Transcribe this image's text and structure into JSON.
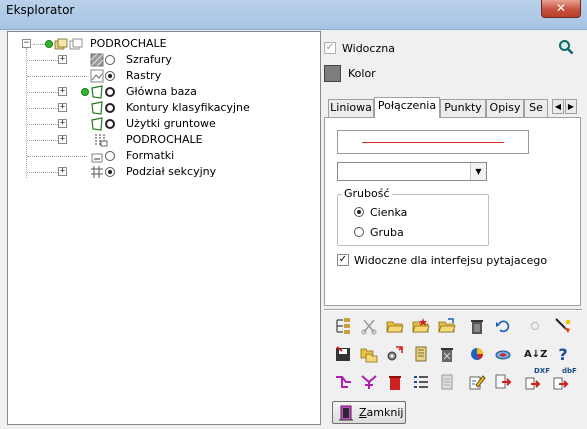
{
  "window": {
    "title": "Eksplorator",
    "close_glyph": "✕"
  },
  "tree": {
    "root": {
      "label": "PODROCHALE",
      "expander": "−"
    },
    "items": [
      {
        "label": "Szrafury",
        "expander": "+",
        "icon": "hatch-layers-icon",
        "radio": "empty"
      },
      {
        "label": "Rastry",
        "expander": "",
        "icon": "raster-image-icon",
        "radio": "filled"
      },
      {
        "label": "Główna baza",
        "expander": "+",
        "icon": "polygon-layer-icon",
        "radio": "bold",
        "dot": true
      },
      {
        "label": "Kontury klasyfikacyjne",
        "expander": "+",
        "icon": "polygon-layer-icon",
        "radio": "bold"
      },
      {
        "label": "Użytki gruntowe",
        "expander": "+",
        "icon": "polygon-layer-icon",
        "radio": "bold"
      },
      {
        "label": "PODROCHALE",
        "expander": "+",
        "icon": "document-grid-icon",
        "radio": "none"
      },
      {
        "label": "Formatki",
        "expander": "",
        "icon": "sheet-frame-icon",
        "radio": "empty"
      },
      {
        "label": "Podział sekcyjny",
        "expander": "+",
        "icon": "grid-icon",
        "radio": "filled"
      }
    ]
  },
  "props": {
    "visible": {
      "label": "Widoczna",
      "checked": true
    },
    "color": {
      "label": "Kolor",
      "value": "#7d7d7d"
    },
    "tabs": [
      "Liniowa",
      "Połączenia",
      "Punkty",
      "Opisy",
      "Se"
    ],
    "active_tab": "Połączenia",
    "line_color": "#d8302a",
    "combo_value": "",
    "thickness": {
      "title": "Grubość",
      "options": [
        {
          "label": "Cienka",
          "selected": true
        },
        {
          "label": "Gruba",
          "selected": false
        }
      ]
    },
    "query_visible": {
      "label": "Widoczne dla interfejsu pytajacego",
      "checked": true
    }
  },
  "toolbar": {
    "rows": [
      [
        "layer-tree-icon",
        "scissors-icon",
        "open-folder-icon",
        "open-folder-star-icon",
        "open-folder-arrow-icon",
        "trash-icon",
        "undo-icon",
        "circle-icon",
        "paint-icon"
      ],
      [
        "save-icon",
        "copy-folder-icon",
        "settings-icon",
        "stack-icon",
        "clear-icon",
        "pie-icon",
        "ellipse-icon",
        "sort-az-icon",
        "help-icon"
      ],
      [
        "branch-icon",
        "branch-alt-icon",
        "delete-red-icon",
        "list-icon",
        "calculator-icon",
        "edit-icon",
        "export-icon",
        "export-dxf-icon",
        "export-dbf-icon"
      ]
    ],
    "glyphs": {
      "sort_az": "A↓Z",
      "help": "?",
      "dxf": "DXF",
      "dbf": "dbF"
    }
  },
  "close_button": {
    "label": "Zamknij"
  }
}
